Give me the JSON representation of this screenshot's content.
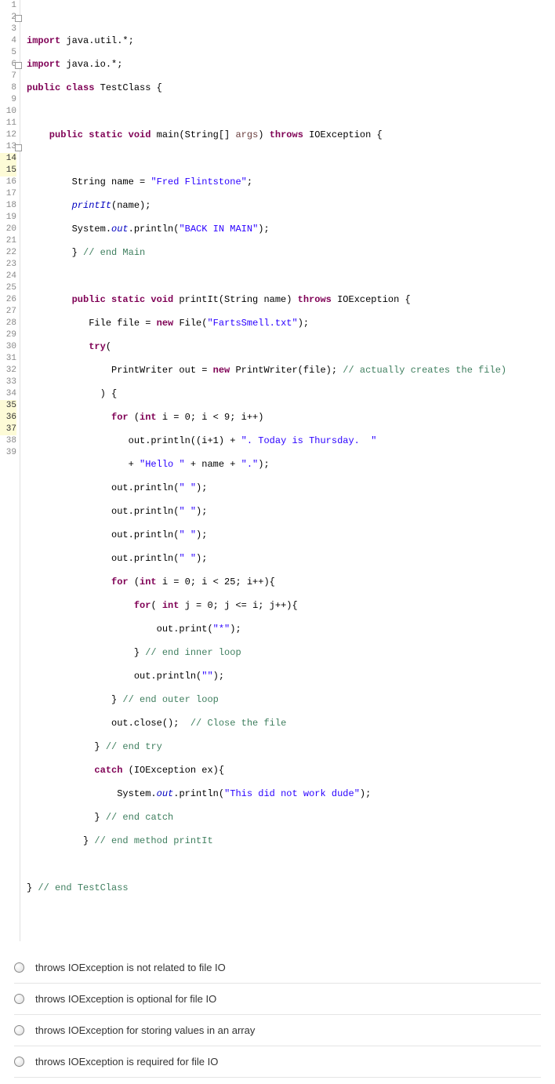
{
  "lines": {
    "l2a": "import",
    "l2b": " java.util.*;",
    "l3a": "import",
    "l3b": " java.io.*;",
    "l4a": "public class",
    "l4b": " TestClass {",
    "l6a": "    public static void",
    "l6b": " main(String[] ",
    "l6c": "args",
    "l6d": ") ",
    "l6e": "throws",
    "l6f": " IOException {",
    "l8a": "        String name = ",
    "l8s": "\"Fred Flintstone\"",
    "l8b": ";",
    "l9a": "        printIt",
    "l9b": "(name);",
    "l10a": "        System.",
    "l10f": "out",
    "l10b": ".println(",
    "l10s": "\"BACK IN MAIN\"",
    "l10c": ");",
    "l11a": "        } ",
    "l11c": "// end Main",
    "l13a": "        public static void",
    "l13b": " printIt(String name) ",
    "l13e": "throws",
    "l13f": " IOException {",
    "l14a": "           File file = ",
    "l14k": "new",
    "l14b": " File(",
    "l14s": "\"FartsSmell.txt\"",
    "l14c": ");",
    "l15a": "           try",
    "l15b": "(",
    "l16a": "               PrintWriter out = ",
    "l16k": "new",
    "l16b": " PrintWriter(file); ",
    "l16c": "// actually creates the file)",
    "l17a": "             ) {",
    "l18a": "               for",
    "l18b": " (",
    "l18k": "int",
    "l18c": " i = 0; i < 9; i++)",
    "l19a": "                  out.println((i+1) + ",
    "l19s": "\". Today is Thursday.  \"",
    "l20a": "                  + ",
    "l20s1": "\"Hello \"",
    "l20b": " + name + ",
    "l20s2": "\".\"",
    "l20c": ");",
    "l21a": "               out.println(",
    "l21s": "\" \"",
    "l21b": ");",
    "l22a": "               out.println(",
    "l22s": "\" \"",
    "l22b": ");",
    "l23a": "               out.println(",
    "l23s": "\" \"",
    "l23b": ");",
    "l24a": "               out.println(",
    "l24s": "\" \"",
    "l24b": ");",
    "l25a": "               for",
    "l25b": " (",
    "l25k": "int",
    "l25c": " i = 0; i < 25; i++){",
    "l26a": "                   for",
    "l26b": "( ",
    "l26k": "int",
    "l26c": " j = 0; j <= i; j++){",
    "l27a": "                       out.print(",
    "l27s": "\"*\"",
    "l27b": ");",
    "l28a": "                   } ",
    "l28c": "// end inner loop",
    "l29a": "                   out.println(",
    "l29s": "\"\"",
    "l29b": ");",
    "l30a": "               } ",
    "l30c": "// end outer loop",
    "l31a": "               out.close();  ",
    "l31c": "// Close the file",
    "l32a": "            } ",
    "l32c": "// end try",
    "l33a": "            catch",
    "l33b": " (IOException ex){",
    "l34a": "                System.",
    "l34f": "out",
    "l34b": ".println(",
    "l34s": "\"This did not work dude\"",
    "l34c": ");",
    "l35a": "            } ",
    "l35c": "// end catch",
    "l36a": "          } ",
    "l36c": "// end method printIt",
    "l38a": "} ",
    "l38c": "// end TestClass"
  },
  "linenumbers": [
    "1",
    "2",
    "3",
    "4",
    "5",
    "6",
    "7",
    "8",
    "9",
    "10",
    "11",
    "12",
    "13",
    "14",
    "15",
    "16",
    "17",
    "18",
    "19",
    "20",
    "21",
    "22",
    "23",
    "24",
    "25",
    "26",
    "27",
    "28",
    "29",
    "30",
    "31",
    "32",
    "33",
    "34",
    "35",
    "36",
    "37",
    "38",
    "39"
  ],
  "options": [
    "throws IOException is not related to file IO",
    "throws IOException is optional for file IO",
    "throws IOException for storing values in an array",
    "throws IOException is required for file IO"
  ]
}
